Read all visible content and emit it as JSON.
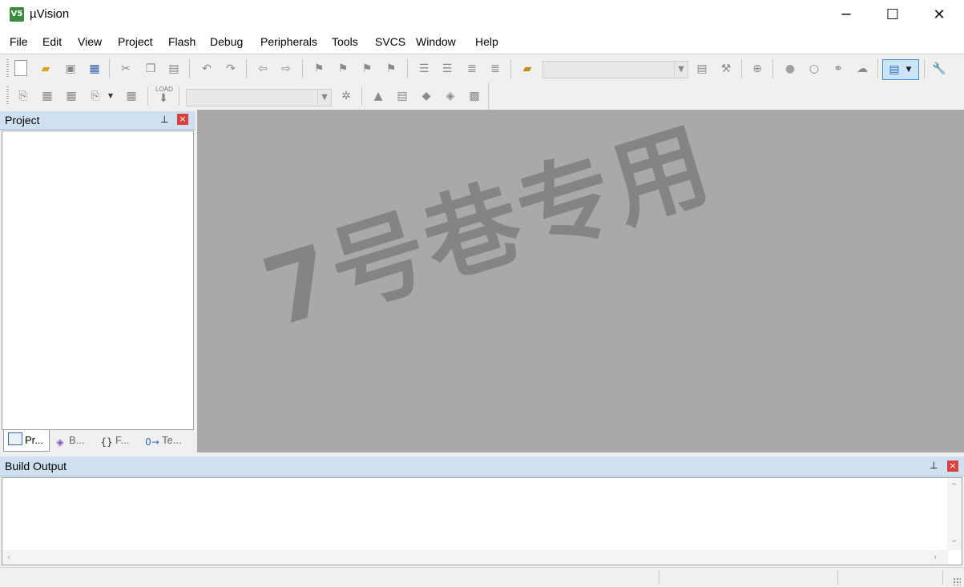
{
  "window": {
    "title": "µVision",
    "app_icon_text": "V5",
    "minimize_glyph": "─",
    "maximize_glyph": "☐",
    "close_glyph": "✕"
  },
  "menu": [
    "File",
    "Edit",
    "View",
    "Project",
    "Flash",
    "Debug",
    "Peripherals",
    "Tools",
    "SVCS",
    "Window",
    "Help"
  ],
  "toolbar1": {
    "icons": [
      "new-file-icon",
      "open-file-icon",
      "save-icon",
      "save-all-icon",
      "cut-icon",
      "copy-icon",
      "paste-icon",
      "undo-icon",
      "redo-icon",
      "navigate-back-icon",
      "navigate-forward-icon",
      "bookmark-insert-icon",
      "bookmark-prev-icon",
      "bookmark-next-icon",
      "bookmark-clear-icon",
      "indent-icon",
      "unindent-icon",
      "comment-icon",
      "uncomment-icon",
      "find-in-files-icon",
      "find-icon",
      "incremental-find-icon",
      "debug-session-icon",
      "breakpoint-icon",
      "breakpoint-disable-icon",
      "breakpoint-disable-all-icon",
      "breakpoint-kill-all-icon",
      "window-layout-icon",
      "configure-icon"
    ],
    "search_combo_value": ""
  },
  "toolbar2": {
    "icons": [
      "translate-icon",
      "build-icon",
      "rebuild-icon",
      "batch-build-icon",
      "stop-build-icon",
      "download-icon",
      "target-options-icon",
      "manage-components-icon",
      "select-software-packs-icon",
      "pack-installer-icon",
      "manage-run-time-icon",
      "event-recorder-icon"
    ],
    "load_label": "LOAD",
    "target_combo_value": ""
  },
  "project_panel": {
    "title": "Project",
    "pin_glyph": "⊥",
    "close_glyph": "×",
    "tabs": [
      {
        "label": "Pr...",
        "icon": "project-tab-icon"
      },
      {
        "label": "B...",
        "icon": "books-tab-icon"
      },
      {
        "label": "F...",
        "icon": "functions-tab-icon",
        "glyph": "{}"
      },
      {
        "label": "Te...",
        "icon": "templates-tab-icon",
        "glyph": "0→"
      }
    ]
  },
  "editor": {
    "watermark": "7号巷专用"
  },
  "build_output": {
    "title": "Build Output",
    "pin_glyph": "⊥",
    "close_glyph": "×",
    "content": ""
  },
  "colors": {
    "panel_header": "#cfe0f1",
    "editor_bg": "#a9a9a9",
    "close_red": "#d9423e"
  }
}
